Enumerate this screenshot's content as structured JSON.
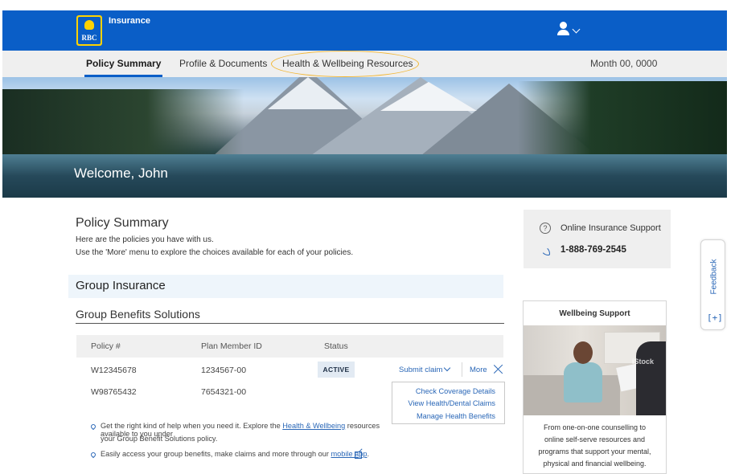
{
  "header": {
    "brand_logo_text": "RBC",
    "product_name": "Insurance"
  },
  "nav": {
    "tabs": [
      {
        "label": "Policy Summary",
        "active": true
      },
      {
        "label": "Profile & Documents",
        "active": false
      },
      {
        "label": "Health & Wellbeing Resources",
        "active": false,
        "highlighted": true
      }
    ],
    "date": "Month 00, 0000"
  },
  "hero": {
    "welcome": "Welcome, John"
  },
  "policy_summary": {
    "title": "Policy Summary",
    "line1": "Here are the policies you have with us.",
    "line2": "Use the 'More' menu to explore the choices available for each of your policies.",
    "group_title": "Group Insurance",
    "section_title": "Group Benefits Solutions",
    "columns": [
      "Policy #",
      "Plan Member ID",
      "Status"
    ],
    "rows": [
      {
        "policy": "W12345678",
        "member_id": "1234567-00",
        "status": "ACTIVE"
      },
      {
        "policy": "W98765432",
        "member_id": "7654321-00",
        "status": ""
      }
    ],
    "submit_claim": "Submit claim",
    "more": "More",
    "more_menu": [
      "Check Coverage Details",
      "View Health/Dental Claims",
      "Manage Health Benefits"
    ],
    "tip1_pre": "Get the right kind of help when you need it. Explore the ",
    "tip1_link": "Health & Wellbeing",
    "tip1_post": " resources available to you under",
    "tip1_line2": "your Group Benefit Solutions policy.",
    "tip2_pre": "Easily access your group benefits, make claims and more through our ",
    "tip2_link": "mobile app",
    "tip2_post": "."
  },
  "support": {
    "online_label": "Online Insurance Support",
    "phone": "1-888-769-2545"
  },
  "wellbeing": {
    "title": "Wellbeing Support",
    "photo_watermark": "iStock",
    "lines": [
      "From one-on-one counselling to",
      "online self-serve resources and",
      "programs that support your mental,",
      "physical and financial wellbeing."
    ]
  },
  "feedback": {
    "label": "Feedback",
    "icon_text": "[+]"
  },
  "colors": {
    "brand_blue": "#0a5ec7",
    "brand_yellow": "#ffd200",
    "link_blue": "#2a67b7",
    "highlight_ring": "#f2b632"
  }
}
